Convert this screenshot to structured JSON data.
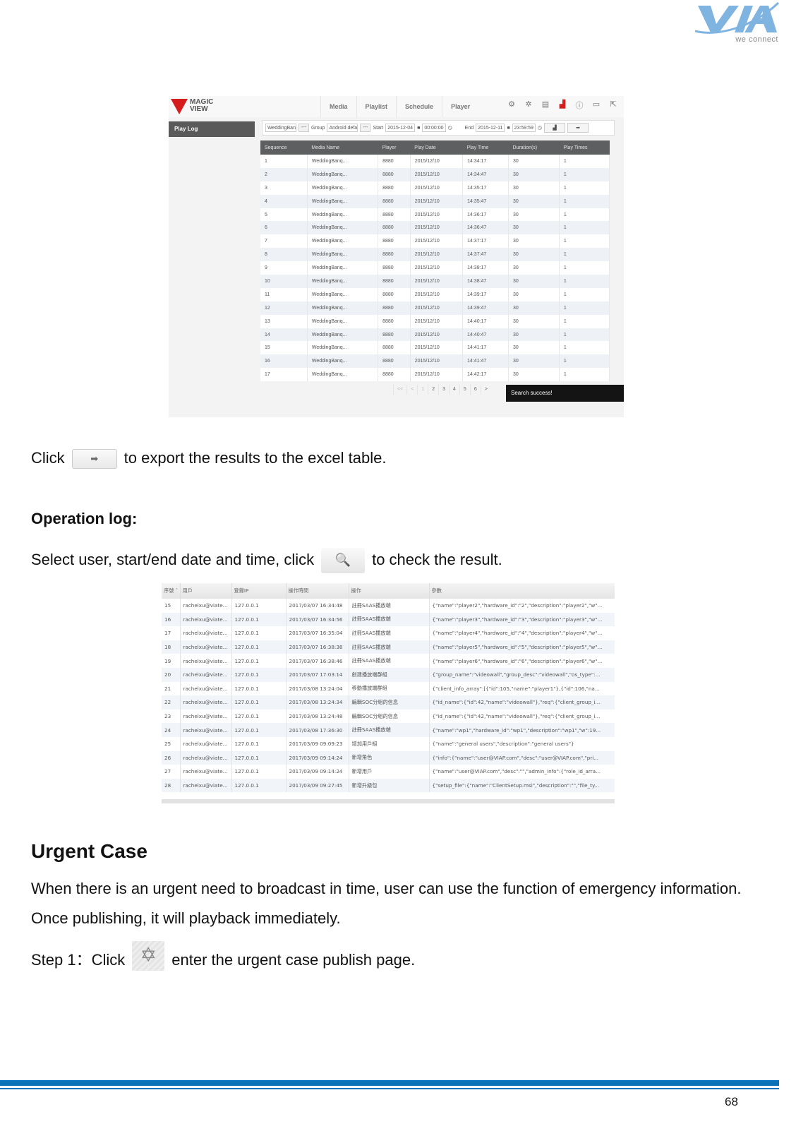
{
  "logo": {
    "name": "VIA",
    "tagline": "we connect",
    "color": "#7fb3e0"
  },
  "playlog_screenshot": {
    "app_logo": {
      "line1": "MAGIC",
      "line2": "VIEW"
    },
    "nav_tabs": [
      "Media",
      "Playlist",
      "Schedule",
      "Player"
    ],
    "nav_icons": [
      "settings-gears-icon",
      "gear-icon",
      "clipboard-icon",
      "bar-chart-icon",
      "info-icon",
      "window-icon",
      "export-icon"
    ],
    "sidebar": {
      "item": "Play Log"
    },
    "filters": {
      "media_value": "WeddingBanq",
      "browse_label": "---",
      "group_label": "Group",
      "group_value": "Android defa",
      "start_label": "Start",
      "start_date": "2015-12-04",
      "start_time": "00:00:00",
      "end_label": "End",
      "end_date": "2015-12-11",
      "end_time": "23:59:59",
      "chart_button": "▟",
      "export_button": "➡"
    },
    "columns": [
      "Sequence",
      "Media Name",
      "Player",
      "Play Date",
      "Play Time",
      "Duration(s)",
      "Play Times"
    ],
    "rows": [
      [
        "1",
        "WeddingBanq...",
        "8880",
        "2015/12/10",
        "14:34:17",
        "30",
        "1"
      ],
      [
        "2",
        "WeddingBanq...",
        "8880",
        "2015/12/10",
        "14:34:47",
        "30",
        "1"
      ],
      [
        "3",
        "WeddingBanq...",
        "8880",
        "2015/12/10",
        "14:35:17",
        "30",
        "1"
      ],
      [
        "4",
        "WeddingBanq...",
        "8880",
        "2015/12/10",
        "14:35:47",
        "30",
        "1"
      ],
      [
        "5",
        "WeddingBanq...",
        "8880",
        "2015/12/10",
        "14:36:17",
        "30",
        "1"
      ],
      [
        "6",
        "WeddingBanq...",
        "8880",
        "2015/12/10",
        "14:36:47",
        "30",
        "1"
      ],
      [
        "7",
        "WeddingBanq...",
        "8880",
        "2015/12/10",
        "14:37:17",
        "30",
        "1"
      ],
      [
        "8",
        "WeddingBanq...",
        "8880",
        "2015/12/10",
        "14:37:47",
        "30",
        "1"
      ],
      [
        "9",
        "WeddingBanq...",
        "8880",
        "2015/12/10",
        "14:38:17",
        "30",
        "1"
      ],
      [
        "10",
        "WeddingBanq...",
        "8880",
        "2015/12/10",
        "14:38:47",
        "30",
        "1"
      ],
      [
        "11",
        "WeddingBanq...",
        "8880",
        "2015/12/10",
        "14:39:17",
        "30",
        "1"
      ],
      [
        "12",
        "WeddingBanq...",
        "8880",
        "2015/12/10",
        "14:39:47",
        "30",
        "1"
      ],
      [
        "13",
        "WeddingBanq...",
        "8880",
        "2015/12/10",
        "14:40:17",
        "30",
        "1"
      ],
      [
        "14",
        "WeddingBanq...",
        "8880",
        "2015/12/10",
        "14:40:47",
        "30",
        "1"
      ],
      [
        "15",
        "WeddingBanq...",
        "8880",
        "2015/12/10",
        "14:41:17",
        "30",
        "1"
      ],
      [
        "16",
        "WeddingBanq...",
        "8880",
        "2015/12/10",
        "14:41:47",
        "30",
        "1"
      ],
      [
        "17",
        "WeddingBanq...",
        "8880",
        "2015/12/10",
        "14:42:17",
        "30",
        "1"
      ]
    ],
    "pager": [
      "<<",
      "<",
      "1",
      "2",
      "3",
      "4",
      "5",
      "6",
      ">"
    ],
    "toast": "Search success!"
  },
  "text": {
    "export_prefix": "Click",
    "export_suffix": "to export the results to the excel table.",
    "export_icon": "➡",
    "oplog_heading": "Operation log:",
    "oplog_prefix": "Select user, start/end date and time, click",
    "oplog_suffix": "to check the result.",
    "search_icon": "🔍",
    "urgent_heading": "Urgent Case",
    "urgent_p1": "When there is an urgent need to broadcast in time, user can use the function of emergency information.",
    "urgent_p2": "Once publishing, it will playback immediately.",
    "step1_prefix": "Step 1：Click",
    "step1_suffix": "enter the urgent case publish page.",
    "step1_icon": "✡"
  },
  "oplog_screenshot": {
    "columns": [
      "序號 ˆ",
      "用戶",
      "登錄IP",
      "操作時間",
      "操作",
      "參數"
    ],
    "rows": [
      [
        "15",
        "rachelxu@viate...",
        "127.0.0.1",
        "2017/03/07 16:34:48",
        "註冊SAAS播放端",
        "{\"name\":\"player2\",\"hardware_id\":\"2\",\"description\":\"player2\",\"w\"..."
      ],
      [
        "16",
        "rachelxu@viate...",
        "127.0.0.1",
        "2017/03/07 16:34:56",
        "註冊SAAS播放端",
        "{\"name\":\"player3\",\"hardware_id\":\"3\",\"description\":\"player3\",\"w\"..."
      ],
      [
        "17",
        "rachelxu@viate...",
        "127.0.0.1",
        "2017/03/07 16:35:04",
        "註冊SAAS播放端",
        "{\"name\":\"player4\",\"hardware_id\":\"4\",\"description\":\"player4\",\"w\"..."
      ],
      [
        "18",
        "rachelxu@viate...",
        "127.0.0.1",
        "2017/03/07 16:38:38",
        "註冊SAAS播放端",
        "{\"name\":\"player5\",\"hardware_id\":\"5\",\"description\":\"player5\",\"w\"..."
      ],
      [
        "19",
        "rachelxu@viate...",
        "127.0.0.1",
        "2017/03/07 16:38:46",
        "註冊SAAS播放端",
        "{\"name\":\"player6\",\"hardware_id\":\"6\",\"description\":\"player6\",\"w\"..."
      ],
      [
        "20",
        "rachelxu@viate...",
        "127.0.0.1",
        "2017/03/07 17:03:14",
        "創建播放端群組",
        "{\"group_name\":\"videowall\",\"group_desc\":\"videowall\",\"os_type\":..."
      ],
      [
        "21",
        "rachelxu@viate...",
        "127.0.0.1",
        "2017/03/08 13:24:04",
        "移動播放端群組",
        "{\"client_info_array\":[{\"id\":105,\"name\":\"player1\"},{\"id\":106,\"na..."
      ],
      [
        "22",
        "rachelxu@viate...",
        "127.0.0.1",
        "2017/03/08 13:24:34",
        "編輯SOC分組的信息",
        "{\"id_name\":{\"id\":42,\"name\":\"videowall\"},\"req\":{\"client_group_i..."
      ],
      [
        "23",
        "rachelxu@viate...",
        "127.0.0.1",
        "2017/03/08 13:24:48",
        "編輯SOC分組的信息",
        "{\"id_name\":{\"id\":42,\"name\":\"videowall\"},\"req\":{\"client_group_i..."
      ],
      [
        "24",
        "rachelxu@viate...",
        "127.0.0.1",
        "2017/03/08 17:36:30",
        "註冊SAAS播放端",
        "{\"name\":\"wp1\",\"hardware_id\":\"wp1\",\"description\":\"wp1\",\"w\":19..."
      ],
      [
        "25",
        "rachelxu@viate...",
        "127.0.0.1",
        "2017/03/09 09:09:23",
        "增加用戶組",
        "{\"name\":\"general users\",\"description\":\"general users\"}"
      ],
      [
        "26",
        "rachelxu@viate...",
        "127.0.0.1",
        "2017/03/09 09:14:24",
        "新增角色",
        "{\"info\":{\"name\":\"user@VIAP.com\",\"desc\":\"user@VIAP.com\",\"pri..."
      ],
      [
        "27",
        "rachelxu@viate...",
        "127.0.0.1",
        "2017/03/09 09:14:24",
        "新增用戶",
        "{\"name\":\"user@VIAP.com\",\"desc\":\"\",\"admin_info\":{\"role_id_arra..."
      ],
      [
        "28",
        "rachelxu@viate...",
        "127.0.0.1",
        "2017/03/09 09:27:45",
        "新增升級包",
        "{\"setup_file\":{\"name\":\"ClientSetup.msi\",\"description\":\"\",\"file_ty..."
      ]
    ]
  },
  "footer": {
    "page_number": "68",
    "bar_color": "#0b71b9"
  }
}
